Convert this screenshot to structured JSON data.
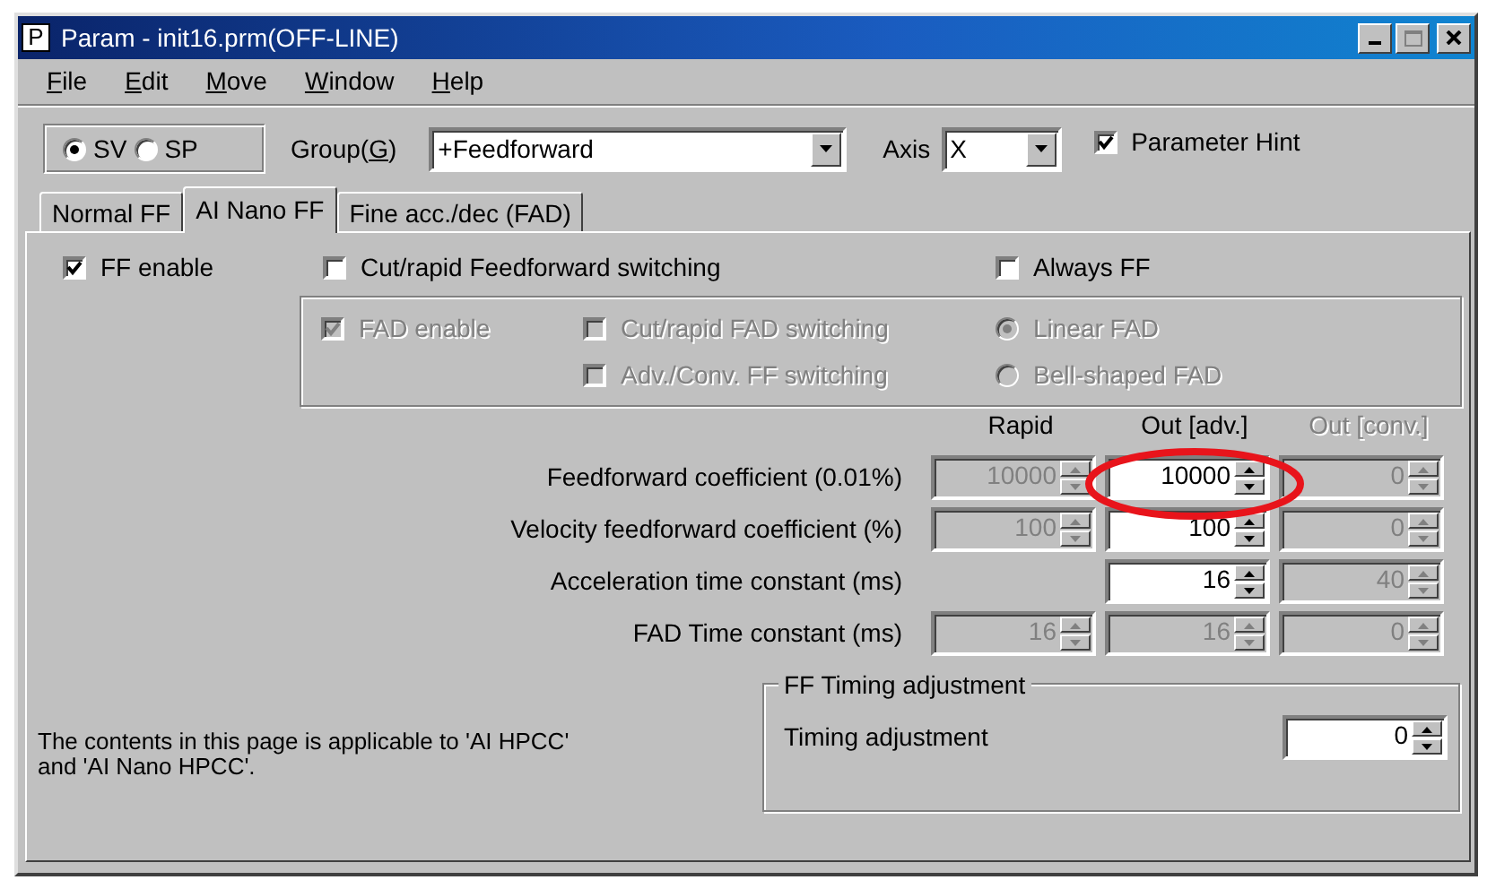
{
  "window": {
    "app_icon": "P",
    "title": "Param - init16.prm(OFF-LINE)"
  },
  "menu": [
    {
      "label": "File"
    },
    {
      "label": "Edit"
    },
    {
      "label": "Move"
    },
    {
      "label": "Window"
    },
    {
      "label": "Help"
    }
  ],
  "toolbar": {
    "mode_options": [
      {
        "label": "SV",
        "selected": true
      },
      {
        "label": "SP",
        "selected": false
      }
    ],
    "group": {
      "label": "Group(G)",
      "value": "+Feedforward"
    },
    "axis": {
      "label": "Axis",
      "value": "X"
    },
    "parameter_hint": {
      "label": "Parameter Hint",
      "checked": true
    }
  },
  "tabs": [
    {
      "label": "Normal FF",
      "selected": false
    },
    {
      "label": "AI Nano FF",
      "selected": true
    },
    {
      "label": "Fine acc./dec (FAD)",
      "selected": false
    }
  ],
  "options": [
    {
      "label": "FF enable",
      "checked": true,
      "disabled": false
    },
    {
      "label": "Cut/rapid Feedforward switching",
      "checked": false,
      "disabled": false
    },
    {
      "label": "Always FF",
      "checked": false,
      "disabled": false
    }
  ],
  "fad_group": [
    [
      {
        "kind": "checkbox",
        "label": "FAD enable",
        "checked": true,
        "disabled": true
      },
      {
        "kind": "checkbox",
        "label": "Cut/rapid FAD switching",
        "checked": false,
        "disabled": true
      },
      {
        "kind": "radio",
        "label": "Linear FAD",
        "selected": true,
        "disabled": true
      }
    ],
    [
      {
        "kind": "blank"
      },
      {
        "kind": "checkbox",
        "label": "Adv./Conv. FF switching",
        "checked": false,
        "disabled": true
      },
      {
        "kind": "radio",
        "label": "Bell-shaped FAD",
        "selected": false,
        "disabled": true
      }
    ]
  ],
  "columns": [
    {
      "label": "Rapid",
      "disabled": false
    },
    {
      "label": "Out [adv.]",
      "disabled": false
    },
    {
      "label": "Out [conv.]",
      "disabled": true
    }
  ],
  "parameters": [
    {
      "label": "Feedforward coefficient (0.01%)",
      "cells": [
        {
          "value": "10000",
          "disabled": true
        },
        {
          "value": "10000",
          "disabled": false
        },
        {
          "value": "0",
          "disabled": true
        }
      ]
    },
    {
      "label": "Velocity feedforward coefficient (%)",
      "cells": [
        {
          "value": "100",
          "disabled": true
        },
        {
          "value": "100",
          "disabled": false
        },
        {
          "value": "0",
          "disabled": true
        }
      ]
    },
    {
      "label": "Acceleration time constant (ms)",
      "cells": [
        null,
        {
          "value": "16",
          "disabled": false
        },
        {
          "value": "40",
          "disabled": true
        }
      ]
    },
    {
      "label": "FAD Time constant (ms)",
      "cells": [
        {
          "value": "16",
          "disabled": true
        },
        {
          "value": "16",
          "disabled": true
        },
        {
          "value": "0",
          "disabled": true
        }
      ]
    }
  ],
  "note": "The contents in this page is applicable to 'AI HPCC' and 'AI Nano HPCC'.",
  "timing_group": {
    "title": "FF Timing adjustment",
    "label": "Timing adjustment",
    "value": "0",
    "disabled": false
  },
  "annotation": {
    "kind": "ellipse",
    "color": "#e8141b"
  }
}
